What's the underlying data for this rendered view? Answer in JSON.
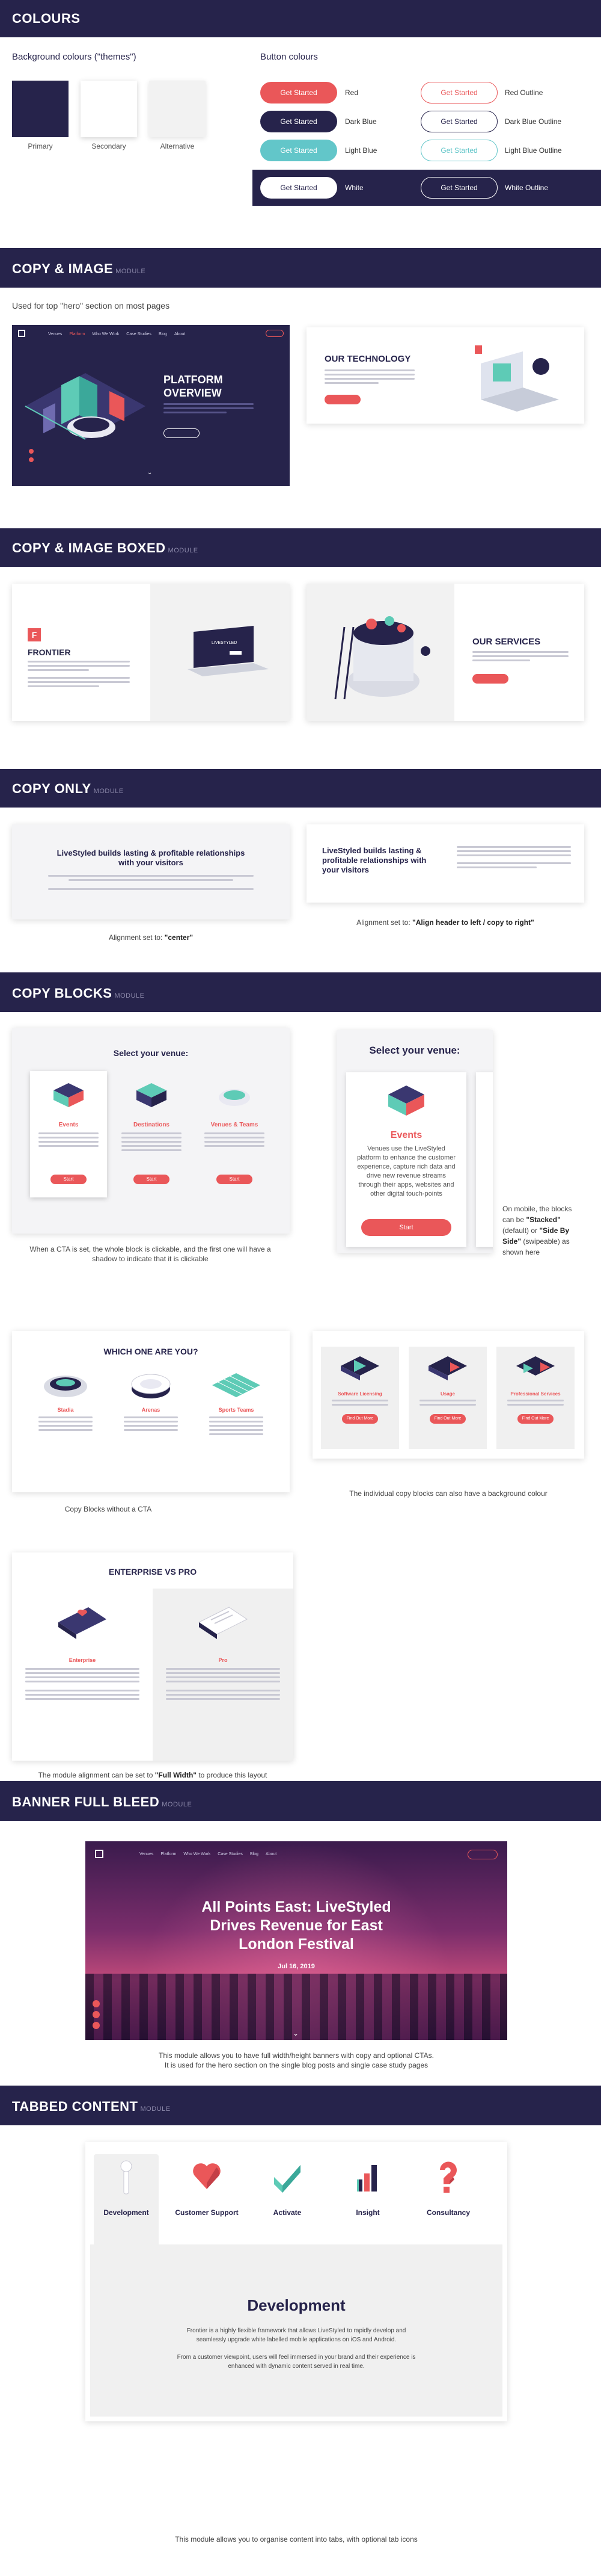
{
  "sections": {
    "colours": "COLOURS",
    "copy_image": "COPY & IMAGE",
    "copy_image_tag": "MODULE",
    "copy_image_boxed": "COPY & IMAGE BOXED",
    "copy_image_boxed_tag": "MODULE",
    "copy_only": "COPY ONLY",
    "copy_only_tag": "MODULE",
    "copy_blocks": "COPY BLOCKS",
    "copy_blocks_tag": "MODULE",
    "banner": "BANNER FULL BLEED",
    "banner_tag": "MODULE",
    "tabbed": "TABBED CONTENT",
    "tabbed_tag": "MODULE"
  },
  "colours": {
    "bg_title": "Background colours (\"themes\")",
    "btn_title": "Button colours",
    "swatches": [
      {
        "label": "Primary",
        "color": "#26234b"
      },
      {
        "label": "Secondary",
        "color": "#ffffff"
      },
      {
        "label": "Alternative",
        "color": "#f2f2f2"
      }
    ],
    "button_text": "Get Started",
    "buttons": [
      {
        "label": "Red",
        "outline": "Red Outline",
        "color": "#ea5759"
      },
      {
        "label": "Dark Blue",
        "outline": "Dark Blue Outline",
        "color": "#26234b"
      },
      {
        "label": "Light Blue",
        "outline": "Light Blue Outline",
        "color": "#62c6c9"
      },
      {
        "label": "White",
        "outline": "White Outline",
        "color": "#ffffff"
      }
    ]
  },
  "copy_image": {
    "caption": "Used for top \"hero\" section on most pages",
    "hero_title_1": "PLATFORM",
    "hero_title_2": "OVERVIEW",
    "nav": [
      "Venues",
      "Platform",
      "Who We Work",
      "Case Studies",
      "Blog",
      "About"
    ],
    "tech_title": "OUR TECHNOLOGY"
  },
  "copy_image_boxed": {
    "frontier_title": "FRONTIER",
    "services_title": "OUR SERVICES",
    "frontier_logo": "LIVESTYLED"
  },
  "copy_only": {
    "headline": "LiveStyled builds lasting & profitable relationships with your visitors",
    "caption_1_prefix": "Alignment set to: ",
    "caption_1_value": "\"center\"",
    "caption_2_prefix": "Alignment set to: ",
    "caption_2_value": "\"Align header to left / copy to right\""
  },
  "copy_blocks": {
    "venue_title": "Select your venue:",
    "venue_items": [
      {
        "name": "Events"
      },
      {
        "name": "Destinations"
      },
      {
        "name": "Venues & Teams"
      }
    ],
    "start_label": "Start",
    "mobile_events_name": "Events",
    "mobile_events_text": "Venues use the LiveStyled platform to enhance the customer experience, capture rich data and drive new revenue streams through their apps, websites and other digital touch-points",
    "caption_cta": "When a CTA is set, the whole block is clickable, and the first one will have a shadow to indicate that it is clickable",
    "mobile_note_1": "On mobile, the blocks can be",
    "mobile_note_stacked": "\"Stacked\"",
    "mobile_note_2": " (default) or ",
    "mobile_note_side": "\"Side By Side\"",
    "mobile_note_3": " (swipeable) as shown here",
    "which_title": "WHICH ONE ARE YOU?",
    "which_items": [
      "Stadia",
      "Arenas",
      "Sports Teams"
    ],
    "caption_no_cta": "Copy Blocks without a CTA",
    "bg_items": [
      "Software Licensing",
      "Usage",
      "Professional Services"
    ],
    "bg_button": "Find Out More",
    "caption_bg": "The individual copy blocks can also have a background colour",
    "ent_title": "ENTERPRISE VS PRO",
    "ent_items": [
      "Enterprise",
      "Pro"
    ],
    "caption_fw_prefix": "The module alignment can be set to ",
    "caption_fw_value": "\"Full Width\"",
    "caption_fw_suffix": " to produce this layout"
  },
  "banner": {
    "title_1": "All Points East: LiveStyled",
    "title_2": "Drives Revenue for East",
    "title_3": "London Festival",
    "date": "Jul 16, 2019",
    "caption_1": "This module allows you to have full width/height banners with copy and optional CTAs.",
    "caption_2": "It is used for the hero section on the single blog posts and single case study pages"
  },
  "tabbed": {
    "tabs": [
      "Development",
      "Customer Support",
      "Activate",
      "Insight",
      "Consultancy"
    ],
    "heading": "Development",
    "para_1": "Frontier is a highly flexible framework that allows LiveStyled to rapidly develop and seamlessly upgrade white labelled mobile applications on iOS and Android.",
    "para_2": "From a customer viewpoint, users will feel immersed in your brand and their experience is enhanced with dynamic content served in real time.",
    "caption": "This module allows you to organise content into tabs, with optional tab icons"
  }
}
